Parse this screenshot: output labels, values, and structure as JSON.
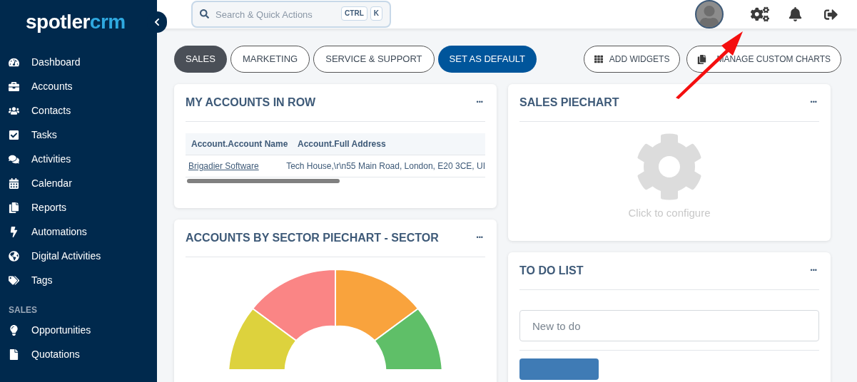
{
  "logo": {
    "primary": "spotler",
    "accent": "crm"
  },
  "sidebar": {
    "items": [
      {
        "label": "Dashboard"
      },
      {
        "label": "Accounts"
      },
      {
        "label": "Contacts"
      },
      {
        "label": "Tasks"
      },
      {
        "label": "Activities"
      },
      {
        "label": "Calendar"
      },
      {
        "label": "Reports"
      },
      {
        "label": "Automations"
      },
      {
        "label": "Digital Activities"
      },
      {
        "label": "Tags"
      }
    ],
    "sections": [
      {
        "title": "SALES",
        "items": [
          {
            "label": "Opportunities"
          },
          {
            "label": "Quotations"
          }
        ]
      }
    ]
  },
  "search": {
    "placeholder": "Search & Quick Actions",
    "keys": [
      "CTRL",
      "K"
    ]
  },
  "tabs": [
    {
      "label": "SALES",
      "selected": true
    },
    {
      "label": "MARKETING",
      "selected": false
    },
    {
      "label": "SERVICE & SUPPORT",
      "selected": false
    }
  ],
  "default_button": "SET AS DEFAULT",
  "actions": [
    "ADD WIDGETS",
    "MANAGE CUSTOM CHARTS"
  ],
  "accounts_widget": {
    "title": "MY ACCOUNTS IN ROW",
    "menu": "•••",
    "columns": [
      "Account.Account Name",
      "Account.Full Address"
    ],
    "rows": [
      [
        "Brigadier Software",
        "Tech House,\\r\\n55 Main Road, London, E20 3CE, UI"
      ]
    ]
  },
  "sector_widget": {
    "title": "ACCOUNTS BY SECTOR PIECHART - SECTOR",
    "menu": "•••"
  },
  "sales_widget": {
    "title": "SALES PIECHART",
    "menu": "•••",
    "hint": "Click to configure"
  },
  "todo_widget": {
    "title": "TO DO LIST",
    "menu": "•••",
    "placeholder": "New to do"
  }
}
